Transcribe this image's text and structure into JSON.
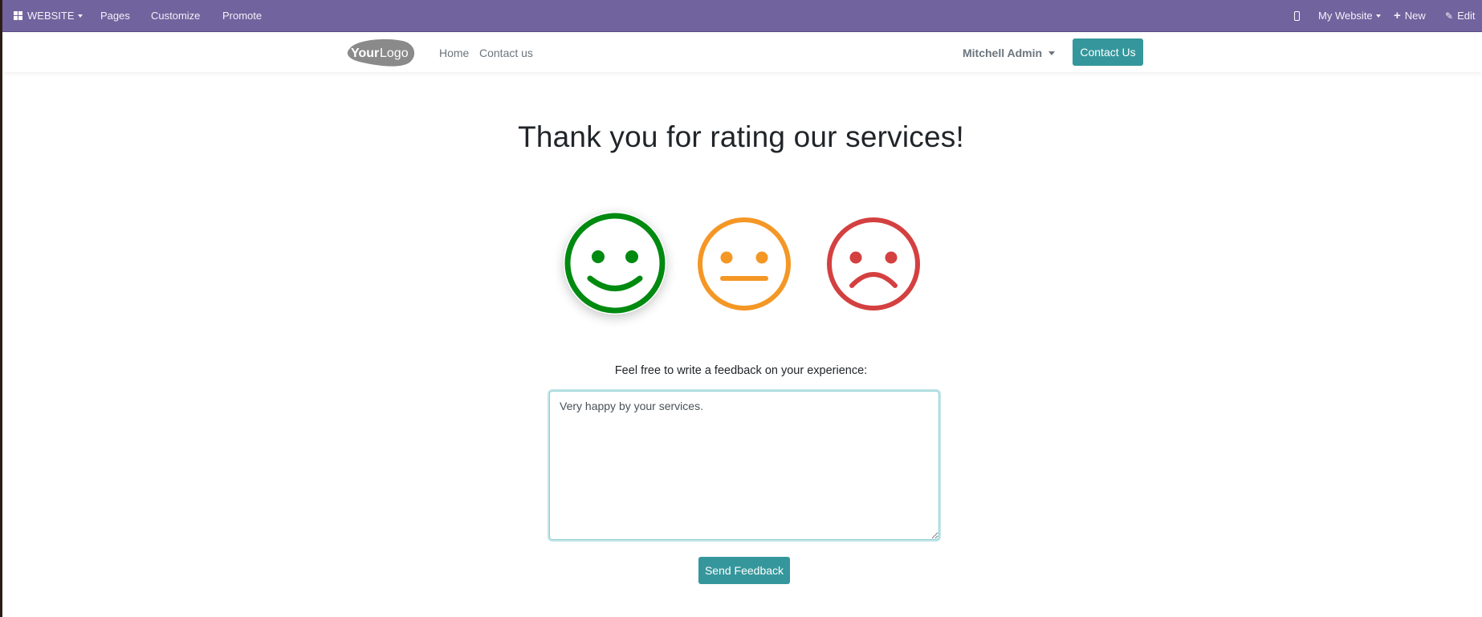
{
  "admin_bar": {
    "app_menu": {
      "icon": "apps-grid-icon",
      "label": "WEBSITE"
    },
    "menu_items": [
      "Pages",
      "Customize",
      "Promote"
    ],
    "right": {
      "mobile_preview_icon": "mobile-icon",
      "website_selector": "My Website",
      "new_label": "New",
      "edit_label": "Edit"
    },
    "color": "#71639e"
  },
  "site_header": {
    "logo": {
      "bold": "Your",
      "light": "Logo"
    },
    "nav": [
      "Home",
      "Contact us"
    ],
    "user_menu": "Mitchell Admin",
    "cta_label": "Contact Us",
    "accent_color": "#35979c"
  },
  "main": {
    "title": "Thank you for rating our services!",
    "ratings": [
      {
        "name": "satisfied",
        "color": "#008a10",
        "selected": true
      },
      {
        "name": "okay",
        "color": "#f49725",
        "selected": false
      },
      {
        "name": "dissatisfied",
        "color": "#d44040",
        "selected": false
      }
    ],
    "feedback_label": "Feel free to write a feedback on your experience:",
    "feedback_value": "Very happy by your services.",
    "submit_label": "Send Feedback"
  }
}
